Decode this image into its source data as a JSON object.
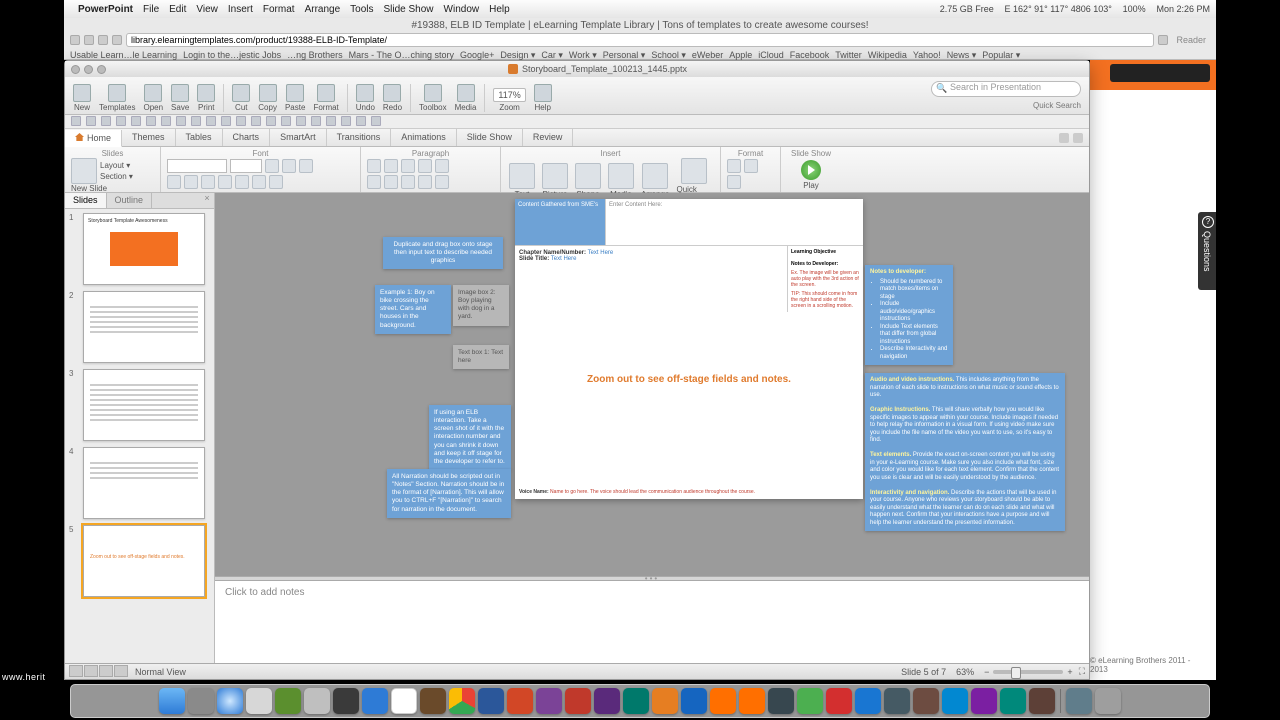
{
  "mac_menu": {
    "app": "PowerPoint",
    "items": [
      "File",
      "Edit",
      "View",
      "Insert",
      "Format",
      "Arrange",
      "Tools",
      "Slide Show",
      "Window",
      "Help"
    ],
    "status": {
      "free": "2.75 GB Free",
      "coords": "E 162° 91° 117° 4806 103°",
      "battery": "100%",
      "clock": "Mon 2:26 PM"
    }
  },
  "browser": {
    "title": "#19388, ELB ID Template | eLearning Template Library | Tons of templates to create awesome courses!",
    "url": "library.elearningtemplates.com/product/19388-ELB-ID-Template/",
    "reader": "Reader",
    "bookmarks": [
      "Usable Learn…le Learning",
      "Login to the…jestic Jobs",
      "…ng Brothers",
      "Mars - The O…ching story",
      "Google+",
      "Design ▾",
      "Car ▾",
      "Work ▾",
      "Personal ▾",
      "School ▾",
      "eWeber",
      "Apple",
      "iCloud",
      "Facebook",
      "Twitter",
      "Wikipedia",
      "Yahoo!",
      "News ▾",
      "Popular ▾"
    ]
  },
  "site": {
    "copyright": "© eLearning Brothers 2011 - 2013"
  },
  "questions_tab": "Questions",
  "ppt": {
    "filename": "Storyboard_Template_100213_1445.pptx",
    "toolbar": {
      "items": [
        "New",
        "Templates",
        "Open",
        "Save",
        "Print",
        "Cut",
        "Copy",
        "Paste",
        "Format",
        "Undo",
        "Redo",
        "Toolbox",
        "Media"
      ],
      "zoom_label": "Zoom",
      "zoom_value": "117%",
      "help": "Help",
      "search_placeholder": "Search in Presentation",
      "quick_search": "Quick Search"
    },
    "ribbon_tabs": [
      "Home",
      "Themes",
      "Tables",
      "Charts",
      "SmartArt",
      "Transitions",
      "Animations",
      "Slide Show",
      "Review"
    ],
    "ribbon_groups": {
      "slides": {
        "label": "Slides",
        "new_slide": "New Slide",
        "layout": "Layout ▾",
        "section": "Section ▾"
      },
      "font": {
        "label": "Font"
      },
      "paragraph": {
        "label": "Paragraph"
      },
      "insert": {
        "label": "Insert",
        "items": [
          "Text",
          "Picture",
          "Shape",
          "Media",
          "Arrange",
          "Quick Styles"
        ]
      },
      "format": {
        "label": "Format"
      },
      "slideshow": {
        "label": "Slide Show",
        "play": "Play"
      }
    },
    "thumb_tabs": {
      "slides": "Slides",
      "outline": "Outline"
    },
    "status": {
      "view": "Normal View",
      "slide": "Slide 5 of 7",
      "zoom": "63%"
    },
    "notes_placeholder": "Click to add notes"
  },
  "slides_panel": {
    "items": [
      {
        "n": "1",
        "title": "Storyboard Template Awesomeness"
      },
      {
        "n": "2",
        "title": ""
      },
      {
        "n": "3",
        "title": ""
      },
      {
        "n": "4",
        "title": ""
      },
      {
        "n": "5",
        "title": ""
      }
    ]
  },
  "slide": {
    "content_gathered": "Content Gathered from SME's",
    "enter_content": "Enter Content Here:",
    "chapter_label": "Chapter Name/Number:",
    "chapter_value": "Text Here",
    "slide_title_label": "Slide Title:",
    "slide_title_value": "Text Here",
    "objective_label": "Learning Objective",
    "notes_dev_label": "Notes to Developer:",
    "notes_dev_red1": "Ex. The image will be given an auto play with the 3rd action of the screen.",
    "notes_dev_red2": "TIP: This should come in from the right hand side of the screen in a scrolling motion.",
    "center_text": "Zoom out to see off-stage fields and notes.",
    "voice_label": "Voice Name:",
    "voice_red": "Name to go here. The voice should lead the communication audience throughout the course."
  },
  "offstage": {
    "b1": "Duplicate and drag box onto stage then input text to describe needed graphics",
    "b2": "Example 1: Boy on bike crossing the street. Cars and houses in the background.",
    "b3": "Image box 2: Boy playing with dog in a yard.",
    "b4": "Text box 1: Text here",
    "b5": "If using an ELB interaction. Take a screen shot of it with the interaction number and you can shrink it down and keep it off stage for the developer to refer to.",
    "b6": "All Narration should be scripted out in \"Notes\" Section. Narration should be in the format of [Narration]. This will allow you to CTRL+F \"[Narration]\" to search for narration in the document.",
    "b7_h": "Notes to developer:",
    "b7_items": [
      "Should be numbered to match boxes/items on stage",
      "Include audio/video/graphics instructions",
      "Include Text elements that differ from global instructions",
      "Describe Interactivity and navigation"
    ],
    "b8_audio_h": "Audio and video instructions.",
    "b8_audio": " This includes anything from the narration of each slide to instructions on what music or sound effects to use.",
    "b8_graphic_h": "Graphic Instructions.",
    "b8_graphic": " This will share verbally how you would like specific images to appear within your course. Include images if needed to help relay the information in a visual form. If using video make sure you include the file name of the video you want to use, so it's easy to find.",
    "b8_text_h": "Text elements.",
    "b8_text": " Provide the exact on-screen content you will be using in your e-Learning course. Make sure you also include what font, size and color you would like for each text element. Confirm that the content you use is clear and will be easily understood by the audience.",
    "b8_nav_h": "Interactivity and navigation.",
    "b8_nav": " Describe the actions that will be used in your course. Anyone who reviews your storyboard should be able to easily understand what the learner can do on each slide and what will happen next. Confirm that your interactions have a purpose and will help the learner understand the presented information."
  },
  "watermark": "www.herit"
}
